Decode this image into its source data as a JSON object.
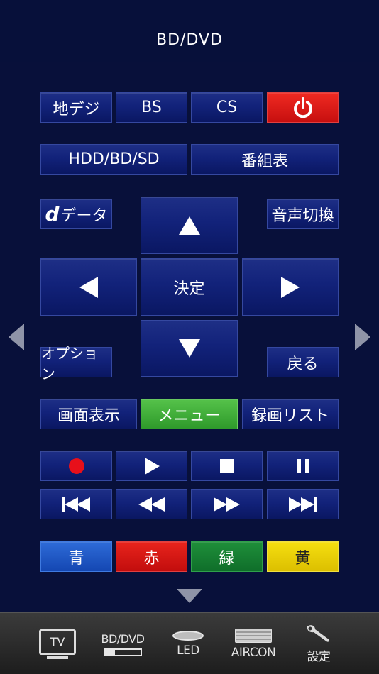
{
  "header": {
    "title": "BD/DVD"
  },
  "rows": {
    "source": [
      "地デジ",
      "BS",
      "CS"
    ],
    "hdd_label": "HDD/BD/SD",
    "epg_label": "番組表",
    "ddata_logo": "d",
    "ddata_label": "データ",
    "audio_label": "音声切換",
    "enter_label": "決定",
    "option_label": "オプション",
    "back_label": "戻る",
    "display_label": "画面表示",
    "menu_label": "メニュー",
    "recordings_label": "録画リスト",
    "colors": [
      "青",
      "赤",
      "緑",
      "黄"
    ]
  },
  "tabbar": {
    "tv": "TV",
    "bd": "BD/DVD",
    "led": "LED",
    "aircon": "AIRCON",
    "settings": "設定"
  },
  "icons": {
    "power": "power-icon",
    "up": "arrow-up-icon",
    "down": "arrow-down-icon",
    "left": "arrow-left-icon",
    "right": "arrow-right-icon",
    "record": "record-icon",
    "play": "play-icon",
    "stop": "stop-icon",
    "pause": "pause-icon",
    "prev": "skip-previous-icon",
    "rewind": "rewind-icon",
    "ff": "fast-forward-icon",
    "next": "skip-next-icon",
    "wrench": "wrench-icon"
  },
  "colors": {
    "background": "#08103a",
    "button": "#12227a",
    "power": "#e01a16",
    "menu": "#42ad3a",
    "blue": "#1f58c6",
    "red": "#d81818",
    "green": "#178033",
    "yellow": "#edd000"
  }
}
